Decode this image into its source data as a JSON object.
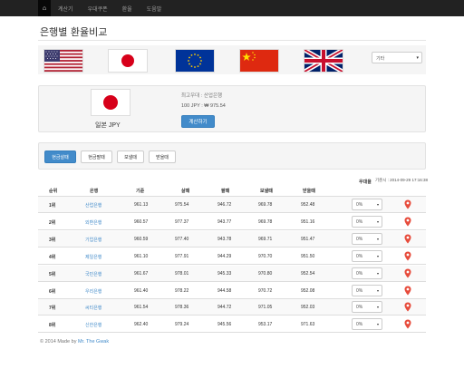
{
  "nav": {
    "home_icon": "home-icon",
    "items": [
      "계산기",
      "우대쿠폰",
      "환율",
      "도움말"
    ]
  },
  "title": "은행별 환율비교",
  "flags": {
    "items": [
      "us-flag",
      "japan-flag",
      "eu-flag",
      "china-flag",
      "uk-flag"
    ],
    "other_select": "기타"
  },
  "selected": {
    "flag": "japan-flag",
    "currency_name": "일본 JPY",
    "best_label": "최고우대 : 산업은행",
    "best_rate": "100 JPY : ₩ 975.54",
    "calc_button": "계산하기"
  },
  "tabs": [
    "현금살때",
    "현금팔때",
    "보낼때",
    "받을때"
  ],
  "active_tab": "현금살때",
  "timestamp": "기준시 : 2014-09-29 17:16:38",
  "table": {
    "headers": [
      "순위",
      "은행",
      "기준",
      "살때",
      "팔때",
      "보낼때",
      "받을때",
      "우대율"
    ],
    "rows": [
      {
        "rank": "1위",
        "bank": "산업은행",
        "base": "961.13",
        "buy": "975.54",
        "sell": "946.72",
        "send": "969.78",
        "receive": "952.48",
        "pct": "0%"
      },
      {
        "rank": "2위",
        "bank": "외환은행",
        "base": "960.57",
        "buy": "977.37",
        "sell": "943.77",
        "send": "969.78",
        "receive": "951.16",
        "pct": "0%"
      },
      {
        "rank": "3위",
        "bank": "기업은행",
        "base": "960.59",
        "buy": "977.40",
        "sell": "943.78",
        "send": "969.71",
        "receive": "951.47",
        "pct": "0%"
      },
      {
        "rank": "4위",
        "bank": "제일은행",
        "base": "961.10",
        "buy": "977.91",
        "sell": "944.29",
        "send": "970.70",
        "receive": "951.50",
        "pct": "0%"
      },
      {
        "rank": "5위",
        "bank": "국민은행",
        "base": "961.67",
        "buy": "978.01",
        "sell": "945.33",
        "send": "970.80",
        "receive": "952.54",
        "pct": "0%"
      },
      {
        "rank": "6위",
        "bank": "우리은행",
        "base": "961.40",
        "buy": "978.22",
        "sell": "944.58",
        "send": "970.72",
        "receive": "952.08",
        "pct": "0%"
      },
      {
        "rank": "7위",
        "bank": "씨티은행",
        "base": "961.54",
        "buy": "978.36",
        "sell": "944.72",
        "send": "971.05",
        "receive": "952.03",
        "pct": "0%"
      },
      {
        "rank": "8위",
        "bank": "신한은행",
        "base": "962.40",
        "buy": "979.24",
        "sell": "945.56",
        "send": "953.17",
        "receive": "971.63",
        "pct": "0%"
      }
    ]
  },
  "footer": {
    "text": "© 2014 Made by ",
    "author": "Mr. The Gwak"
  },
  "colors": {
    "navbar": "#222222",
    "primary": "#428bca",
    "pin": "#e74c3c"
  }
}
